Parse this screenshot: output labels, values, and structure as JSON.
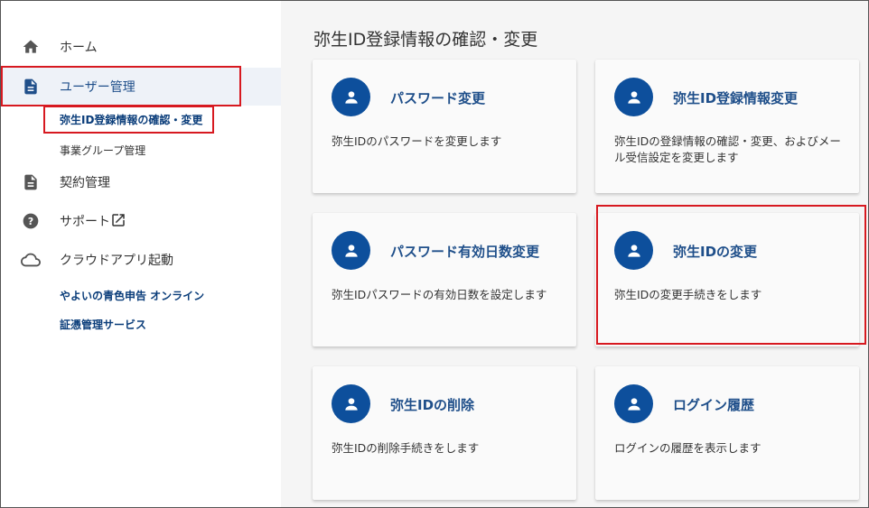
{
  "sidebar": {
    "home_label": "ホーム",
    "user_mgmt_label": "ユーザー管理",
    "sub_items": [
      "弥生ID登録情報の確認・変更",
      "事業グループ管理"
    ],
    "contract_label": "契約管理",
    "support_label": "サポート",
    "cloud_label": "クラウドアプリ起動",
    "links": [
      "やよいの青色申告 オンライン",
      "証憑管理サービス"
    ]
  },
  "main": {
    "page_title": "弥生ID登録情報の確認・変更",
    "cards": [
      {
        "title": "パスワード変更",
        "desc": "弥生IDのパスワードを変更します"
      },
      {
        "title": "弥生ID登録情報変更",
        "desc": "弥生IDの登録情報の確認・変更、およびメール受信設定を変更します"
      },
      {
        "title": "パスワード有効日数変更",
        "desc": "弥生IDパスワードの有効日数を設定します"
      },
      {
        "title": "弥生IDの変更",
        "desc": "弥生IDの変更手続きをします"
      },
      {
        "title": "弥生IDの削除",
        "desc": "弥生IDの削除手続きをします"
      },
      {
        "title": "ログイン履歴",
        "desc": "ログインの履歴を表示します"
      }
    ]
  },
  "icons": {
    "home": "home-icon",
    "user_mgmt": "document-icon",
    "contract": "document-icon",
    "support": "help-icon",
    "external": "external-link-icon",
    "cloud": "cloud-icon",
    "card": "person-icon"
  },
  "colors": {
    "accent": "#0d4f9c",
    "highlight_box": "#d71920",
    "active_bg": "#eef2f8",
    "main_bg": "#f5f5f5"
  }
}
